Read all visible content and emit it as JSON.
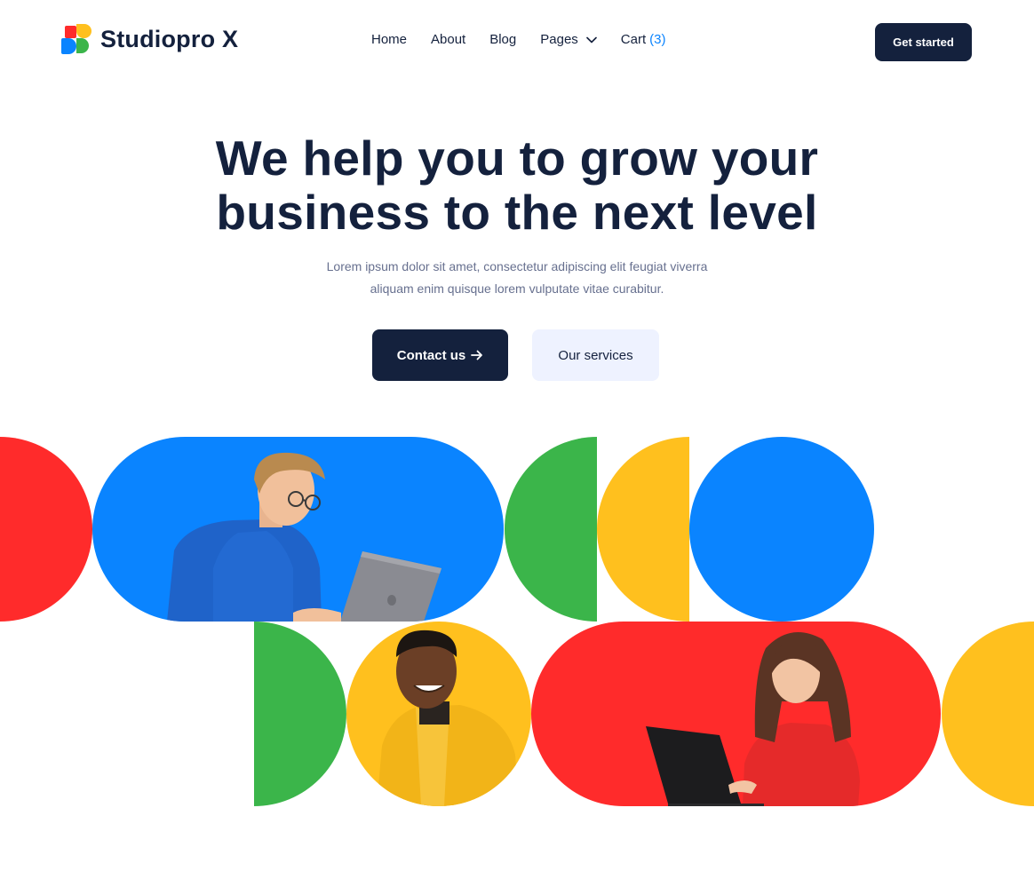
{
  "brand": {
    "name": "Studiopro X"
  },
  "nav": {
    "items": [
      {
        "label": "Home"
      },
      {
        "label": "About"
      },
      {
        "label": "Blog"
      },
      {
        "label": "Pages"
      },
      {
        "label": "Cart"
      }
    ],
    "cart_count": "(3)",
    "cta_label": "Get started"
  },
  "hero": {
    "title_line1": "We help you to grow your",
    "title_line2": "business to the next level",
    "subtitle_line1": "Lorem ipsum dolor sit amet, consectetur adipiscing elit feugiat viverra",
    "subtitle_line2": "aliquam enim quisque lorem vulputate vitae curabitur.",
    "primary_button": "Contact us",
    "secondary_button": "Our services"
  },
  "colors": {
    "navy": "#14213d",
    "red": "#ff2b2b",
    "blue": "#0a84ff",
    "green": "#3bb54a",
    "yellow": "#ffc01e"
  },
  "icons": {
    "pages_dropdown": "chevron-down-icon",
    "contact_arrow": "arrow-right-icon"
  }
}
